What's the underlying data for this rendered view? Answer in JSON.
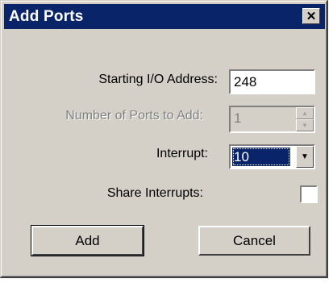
{
  "dialog": {
    "title": "Add Ports",
    "close_glyph": "✕"
  },
  "fields": {
    "starting_address": {
      "label": "Starting I/O Address:",
      "value": "248"
    },
    "number_of_ports": {
      "label": "Number of Ports to Add:",
      "value": "1",
      "enabled": false
    },
    "interrupt": {
      "label": "Interrupt:",
      "value": "10"
    },
    "share_interrupts": {
      "label": "Share Interrupts:",
      "checked": false
    }
  },
  "buttons": {
    "add_label": "Add",
    "cancel_label": "Cancel"
  },
  "icons": {
    "spin_up": "▲",
    "spin_down": "▼",
    "dropdown": "▼"
  },
  "colors": {
    "titlebar": "#0a246a",
    "dialog_face": "#d4d0c8",
    "selection": "#0a246a"
  }
}
